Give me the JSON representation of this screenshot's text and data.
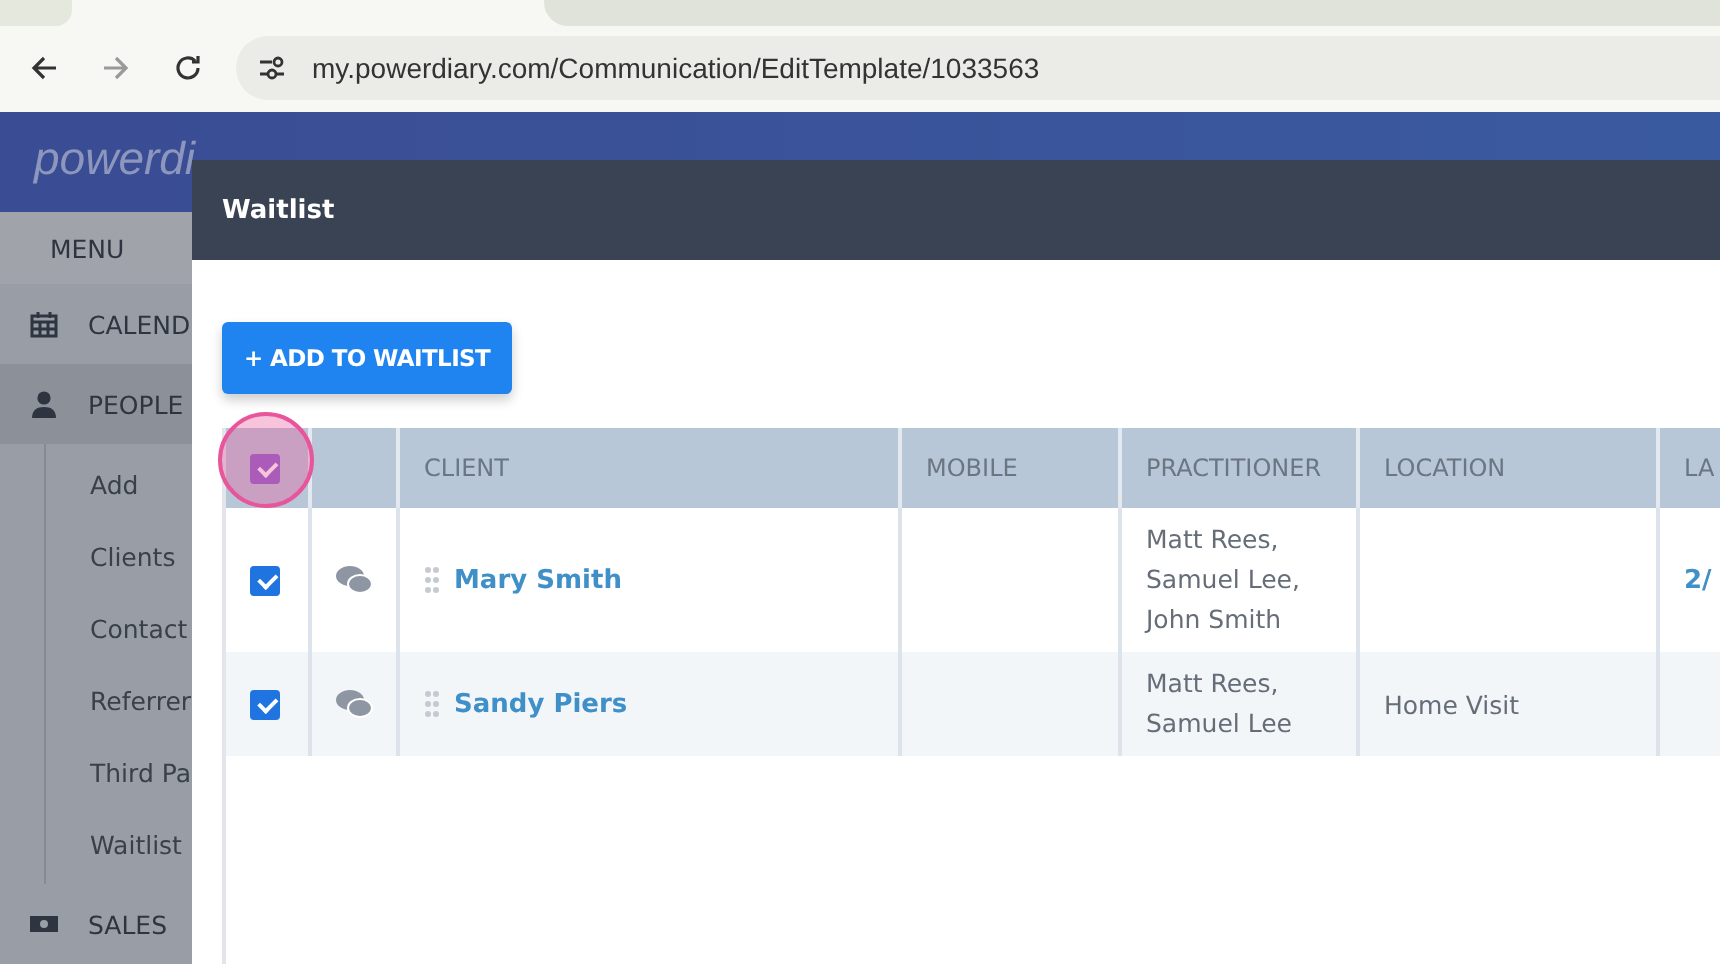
{
  "browser": {
    "url": "my.powerdiary.com/Communication/EditTemplate/1033563"
  },
  "app": {
    "logo": "powerdi"
  },
  "sidebar": {
    "menu_label": "MENU",
    "items": [
      {
        "kind": "calendar",
        "label": "CALEND",
        "selected": false
      },
      {
        "kind": "person",
        "label": "PEOPLE",
        "selected": true,
        "children": [
          {
            "label": "Add"
          },
          {
            "label": "Clients"
          },
          {
            "label": "Contact"
          },
          {
            "label": "Referrer"
          },
          {
            "label": "Third Pa"
          },
          {
            "label": "Waitlist"
          }
        ]
      },
      {
        "kind": "money",
        "label": "SALES",
        "selected": false
      }
    ]
  },
  "modal": {
    "title": "Waitlist",
    "add_button": "+ ADD TO WAITLIST",
    "table": {
      "select_all": {
        "checked": true,
        "highlighted": true
      },
      "columns": [
        "CLIENT",
        "MOBILE",
        "PRACTITIONER",
        "LOCATION",
        "LA"
      ],
      "rows": [
        {
          "checked": true,
          "client": "Mary Smith",
          "practitioner": [
            "Matt Rees,",
            "Samuel Lee,",
            "John Smith"
          ],
          "column_5": "2/"
        },
        {
          "checked": true,
          "client": "Sandy Piers",
          "practitioner": [
            "Matt Rees,",
            "Samuel Lee"
          ],
          "location": "Home Visit"
        }
      ]
    }
  }
}
